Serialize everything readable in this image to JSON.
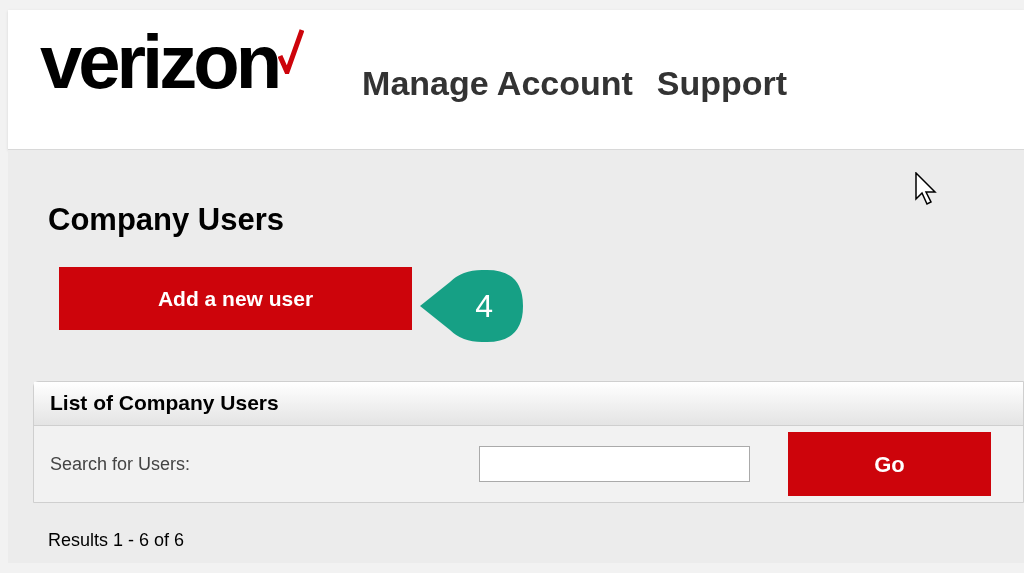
{
  "header": {
    "logo": "verizon",
    "nav": [
      "Manage Account",
      "Support"
    ]
  },
  "page": {
    "title": "Company Users",
    "add_button": "Add a new user",
    "callout": "4"
  },
  "users_panel": {
    "title": "List of Company Users",
    "search_label": "Search for Users:",
    "go_button": "Go",
    "results": "Results 1 - 6 of 6"
  }
}
